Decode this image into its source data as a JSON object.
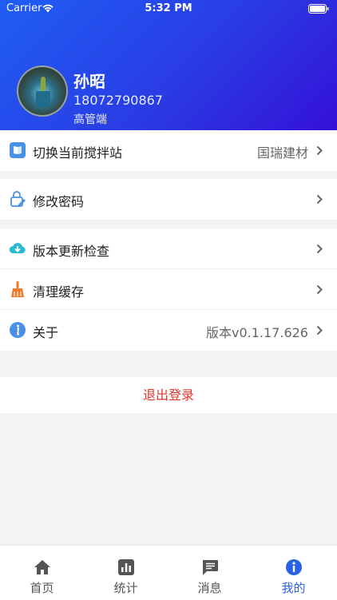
{
  "status_bar": {
    "carrier": "Carrier",
    "time": "5:32 PM"
  },
  "profile": {
    "name": "孙昭",
    "phone": "18072790867",
    "role": "高管端"
  },
  "menu": {
    "switch_station": {
      "label": "切换当前搅拌站",
      "value": "国瑞建材"
    },
    "change_password": {
      "label": "修改密码"
    },
    "version_check": {
      "label": "版本更新检查"
    },
    "clear_cache": {
      "label": "清理缓存"
    },
    "about": {
      "label": "关于",
      "value": "版本v0.1.17.626"
    }
  },
  "logout_label": "退出登录",
  "tabs": [
    {
      "label": "首页",
      "icon": "home-icon"
    },
    {
      "label": "统计",
      "icon": "chart-icon"
    },
    {
      "label": "消息",
      "icon": "message-icon"
    },
    {
      "label": "我的",
      "icon": "info-icon",
      "active": true
    }
  ],
  "colors": {
    "header_gradient_start": "#1f5ef5",
    "header_gradient_end": "#3510d8",
    "accent": "#2a62e6",
    "logout": "#e0342e"
  }
}
